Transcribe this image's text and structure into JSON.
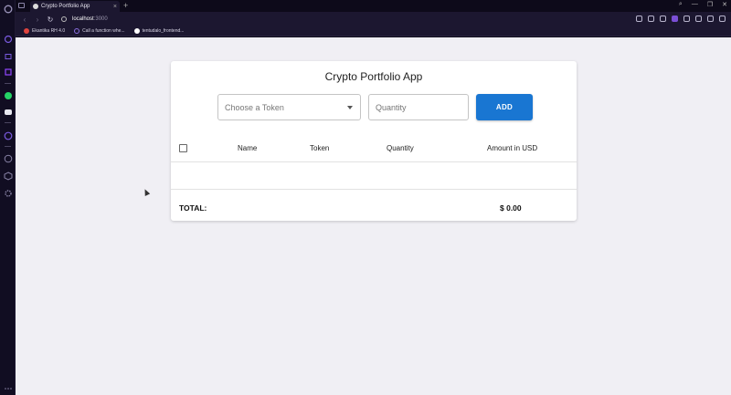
{
  "browser": {
    "tab_title": "Crypto Portfolio App",
    "tab_close": "×",
    "new_tab": "+",
    "url_host": "localhost",
    "url_port": ":3000",
    "window_controls": [
      "⌕",
      "—",
      "❐",
      "✕"
    ],
    "nav": {
      "back": "‹",
      "forward": "›",
      "reload": "↻"
    },
    "bookmarks": [
      {
        "label": "Ekantika RH 4.0",
        "icon": "ekantika-icon",
        "color": "#e0443e"
      },
      {
        "label": "Call a function whe...",
        "icon": "circle-icon",
        "color": "#8a6fe0"
      },
      {
        "label": "tentudalo_frontend...",
        "icon": "github-icon",
        "color": "#ffffff"
      }
    ]
  },
  "app": {
    "title": "Crypto Portfolio App",
    "token_select": {
      "placeholder": "Choose a Token"
    },
    "quantity_input": {
      "placeholder": "Quantity"
    },
    "add_button": "ADD",
    "table": {
      "columns": [
        "Name",
        "Token",
        "Quantity",
        "Amount in USD"
      ],
      "rows": []
    },
    "total_label": "TOTAL:",
    "total_value": "$ 0.00"
  },
  "colors": {
    "accent": "#1976d2",
    "page_bg": "#f0eff4",
    "browser_bg": "#1c1730"
  }
}
